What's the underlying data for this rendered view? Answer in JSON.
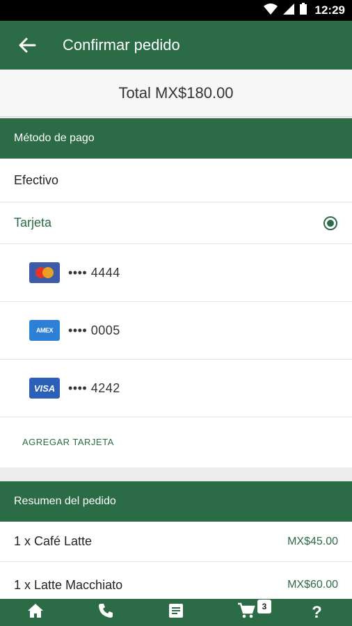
{
  "status_bar": {
    "time": "12:29"
  },
  "app_bar": {
    "title": "Confirmar pedido"
  },
  "total": {
    "label": "Total MX$180.00"
  },
  "payment": {
    "header": "Método de pago",
    "cash_label": "Efectivo",
    "card_label": "Tarjeta",
    "cards": [
      {
        "brand": "mastercard",
        "number": "•••• 4444"
      },
      {
        "brand": "amex",
        "brand_text": "AMEX",
        "number": "•••• 0005"
      },
      {
        "brand": "visa",
        "brand_text": "VISA",
        "number": "•••• 4242"
      }
    ],
    "add_card": "AGREGAR TARJETA"
  },
  "summary": {
    "header": "Resumen del pedido",
    "items": [
      {
        "name": "1 x Café Latte",
        "price": "MX$45.00"
      },
      {
        "name": "1 x Latte Macchiato",
        "price": "MX$60.00"
      }
    ]
  },
  "bottom_nav": {
    "items": [
      "home-icon",
      "phone-icon",
      "orders-icon",
      "cart-icon",
      "help-icon"
    ],
    "cart_badge": "3",
    "help_glyph": "?"
  },
  "colors": {
    "primary": "#2b6b45",
    "background": "#ececec"
  }
}
